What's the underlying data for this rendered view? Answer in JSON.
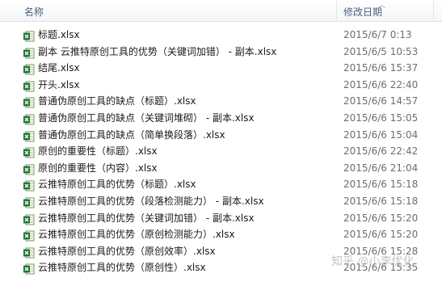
{
  "columns": {
    "name": "名称",
    "date_modified": "修改日期"
  },
  "files": [
    {
      "name": "标题.xlsx",
      "date": "2015/6/7 0:13",
      "icon": "excel-file-icon"
    },
    {
      "name": "副本 云推特原创工具的优势（关键词加错） - 副本.xlsx",
      "date": "2015/6/5 10:53",
      "icon": "excel-file-icon"
    },
    {
      "name": "结尾.xlsx",
      "date": "2015/6/6 15:37",
      "icon": "excel-file-icon"
    },
    {
      "name": "开头.xlsx",
      "date": "2015/6/6 22:40",
      "icon": "excel-file-icon"
    },
    {
      "name": "普通伪原创工具的缺点（标题）.xlsx",
      "date": "2015/6/6 14:57",
      "icon": "excel-file-icon"
    },
    {
      "name": "普通伪原创工具的缺点（关键词堆砌） - 副本.xlsx",
      "date": "2015/6/6 15:05",
      "icon": "excel-file-icon"
    },
    {
      "name": "普通伪原创工具的缺点（简单换段落）.xlsx",
      "date": "2015/6/6 15:04",
      "icon": "excel-file-icon"
    },
    {
      "name": "原创的重要性（标题）.xlsx",
      "date": "2015/6/6 22:42",
      "icon": "excel-file-icon"
    },
    {
      "name": "原创的重要性（内容）.xlsx",
      "date": "2015/6/6 21:04",
      "icon": "excel-file-icon"
    },
    {
      "name": "云推特原创工具的优势（标题）.xlsx",
      "date": "2015/6/6 15:18",
      "icon": "excel-file-icon"
    },
    {
      "name": "云推特原创工具的优势（段落检测能力） - 副本.xlsx",
      "date": "2015/6/6 15:18",
      "icon": "excel-file-icon"
    },
    {
      "name": "云推特原创工具的优势（关键词加错） - 副本.xlsx",
      "date": "2015/6/6 15:20",
      "icon": "excel-file-icon"
    },
    {
      "name": "云推特原创工具的优势（原创检测能力）.xlsx",
      "date": "2015/6/6 15:20",
      "icon": "excel-file-icon"
    },
    {
      "name": "云推特原创工具的优势（原创效率）.xlsx",
      "date": "2015/6/6 15:28",
      "icon": "excel-file-icon"
    },
    {
      "name": "云推特原创工具的优势（原创性）.xlsx",
      "date": "2015/6/6 15:35",
      "icon": "excel-file-icon"
    }
  ],
  "watermark": {
    "main": "知乎 @小李优化"
  }
}
